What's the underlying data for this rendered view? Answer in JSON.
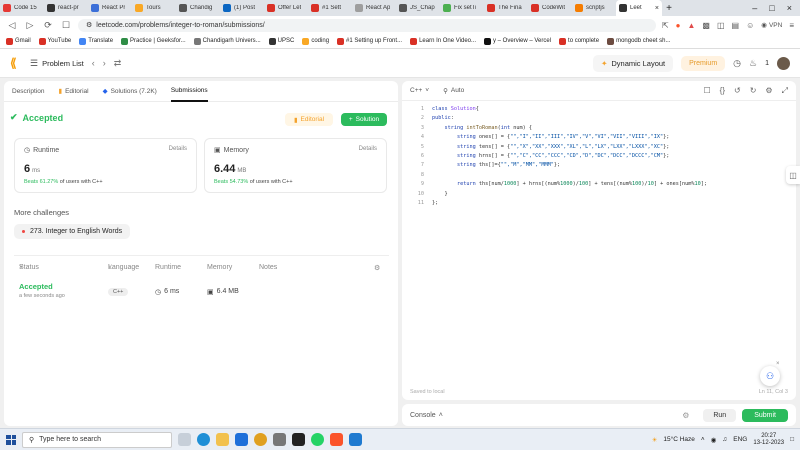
{
  "browser": {
    "tabs": [
      {
        "label": "Code 15",
        "color": "#e53935"
      },
      {
        "label": "react-pr",
        "color": "#333333"
      },
      {
        "label": "React Pr",
        "color": "#3b6fd8"
      },
      {
        "label": "Tours",
        "color": "#f9a825"
      },
      {
        "label": "Chandig",
        "color": "#555555"
      },
      {
        "label": "(1) Post",
        "color": "#0a66c2"
      },
      {
        "label": "Offer Let",
        "color": "#d93025"
      },
      {
        "label": "#1 Sett",
        "color": "#d93025"
      },
      {
        "label": "React Ap",
        "color": "#9e9e9e"
      },
      {
        "label": "JS_Chap",
        "color": "#555555"
      },
      {
        "label": "Fix setTi",
        "color": "#4caf50"
      },
      {
        "label": "The Fina",
        "color": "#d93025"
      },
      {
        "label": "CodeWit",
        "color": "#d93025"
      },
      {
        "label": "scriptjs",
        "color": "#f57c00"
      },
      {
        "label": "Leet",
        "color": "#333333"
      }
    ],
    "new_tab": "+",
    "url": "leetcode.com/problems/integer-to-roman/submissions/",
    "vpn": "VPN",
    "bookmarks": [
      {
        "label": "Gmail",
        "color": "#d93025"
      },
      {
        "label": "YouTube",
        "color": "#d93025"
      },
      {
        "label": "Translate",
        "color": "#4285f4"
      },
      {
        "label": "Practice | Geeksfor...",
        "color": "#2f8d46"
      },
      {
        "label": "Chandigarh Univers...",
        "color": "#777777"
      },
      {
        "label": "UPSC",
        "color": "#333333"
      },
      {
        "label": "coding",
        "color": "#f9a825"
      },
      {
        "label": "#1 Setting up Front...",
        "color": "#d93025"
      },
      {
        "label": "Learn In One Video...",
        "color": "#d93025"
      },
      {
        "label": "y – Overview – Vercel",
        "color": "#111111"
      },
      {
        "label": "to complete",
        "color": "#d93025"
      },
      {
        "label": "mongodb cheet sh...",
        "color": "#6d4c41"
      }
    ]
  },
  "header": {
    "problem_list": "Problem List",
    "dynamic_layout": "Dynamic Layout",
    "premium": "Premium",
    "streak": "1"
  },
  "left": {
    "tabs": {
      "description": "Description",
      "editorial": "Editorial",
      "solutions": "Solutions (7.2K)",
      "submissions": "Submissions"
    },
    "status": "Accepted",
    "editorial_btn": "Editorial",
    "solution_btn": "Solution",
    "runtime": {
      "label": "Runtime",
      "details": "Details",
      "value": "6",
      "unit": "ms",
      "beats": "Beats 61.27%",
      "suffix": "of users with C++"
    },
    "memory": {
      "label": "Memory",
      "details": "Details",
      "value": "6.44",
      "unit": "MB",
      "beats": "Beats 54.73%",
      "suffix": "of users with C++"
    },
    "more_challenges": "More challenges",
    "challenge": "273. Integer to English Words",
    "table": {
      "headers": {
        "status": "Status",
        "language": "Language",
        "runtime": "Runtime",
        "memory": "Memory",
        "notes": "Notes"
      },
      "row": {
        "status": "Accepted",
        "time": "a few seconds ago",
        "language": "C++",
        "runtime": "6 ms",
        "memory": "6.4 MB"
      }
    }
  },
  "editor": {
    "language": "C++",
    "mode": "Auto",
    "line_numbers": [
      "1",
      "2",
      "3",
      "4",
      "5",
      "6",
      "7",
      "8",
      "9",
      "10",
      "11"
    ],
    "saved": "Saved to local",
    "position": "Ln 11, Col 3"
  },
  "console": {
    "label": "Console",
    "run": "Run",
    "submit": "Submit"
  },
  "taskbar": {
    "search": "Type here to search",
    "weather": "15°C  Haze",
    "lang": "ENG",
    "time": "20:27",
    "date": "13-12-2023"
  }
}
